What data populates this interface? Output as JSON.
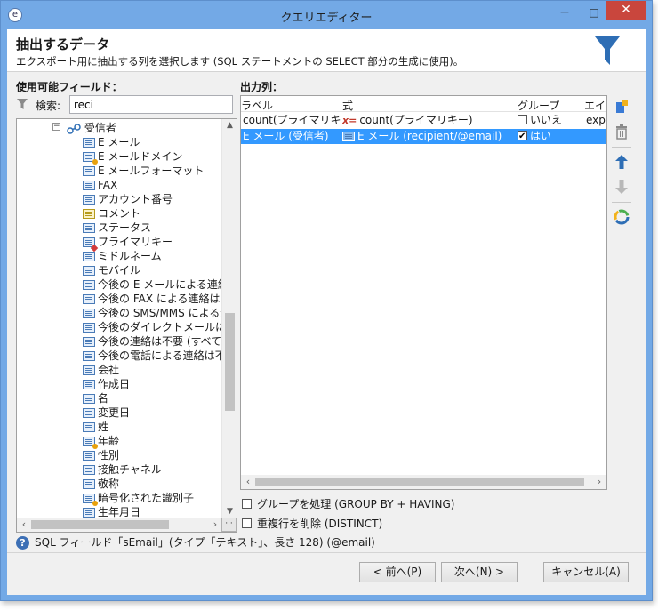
{
  "window": {
    "title": "クエリエディター",
    "minimize": "−",
    "maximize": "□",
    "close": "✕"
  },
  "header": {
    "title": "抽出するデータ",
    "description": "エクスポート用に抽出する列を選択します (SQL ステートメントの SELECT 部分の生成に使用)。"
  },
  "left": {
    "label": "使用可能フィールド：",
    "search_label": "検索:",
    "search_value": "reci",
    "tree": {
      "root_expander": "−",
      "root": "受信者",
      "items": [
        {
          "label": "E メール",
          "icon": "field-icon"
        },
        {
          "label": "E メールドメイン",
          "icon": "computed-field-icon"
        },
        {
          "label": "E メールフォーマット",
          "icon": "field-icon"
        },
        {
          "label": "FAX",
          "icon": "field-icon"
        },
        {
          "label": "アカウント番号",
          "icon": "field-icon"
        },
        {
          "label": "コメント",
          "icon": "memo-field-icon"
        },
        {
          "label": "ステータス",
          "icon": "field-icon"
        },
        {
          "label": "プライマリキー",
          "icon": "primary-key-icon"
        },
        {
          "label": "ミドルネーム",
          "icon": "field-icon"
        },
        {
          "label": "モバイル",
          "icon": "field-icon"
        },
        {
          "label": "今後の E メールによる連絡は",
          "icon": "field-icon"
        },
        {
          "label": "今後の FAX による連絡は不",
          "icon": "field-icon"
        },
        {
          "label": "今後の SMS/MMS による連",
          "icon": "field-icon"
        },
        {
          "label": "今後のダイレクトメールによる連",
          "icon": "field-icon"
        },
        {
          "label": "今後の連絡は不要 (すべての",
          "icon": "field-icon"
        },
        {
          "label": "今後の電話による連絡は不要",
          "icon": "field-icon"
        },
        {
          "label": "会社",
          "icon": "field-icon"
        },
        {
          "label": "作成日",
          "icon": "field-icon"
        },
        {
          "label": "名",
          "icon": "field-icon"
        },
        {
          "label": "変更日",
          "icon": "field-icon"
        },
        {
          "label": "姓",
          "icon": "field-icon"
        },
        {
          "label": "年齢",
          "icon": "computed-field-icon"
        },
        {
          "label": "性別",
          "icon": "field-icon"
        },
        {
          "label": "接触チャネル",
          "icon": "field-icon"
        },
        {
          "label": "敬称",
          "icon": "field-icon"
        },
        {
          "label": "暗号化された識別子",
          "icon": "computed-field-icon"
        },
        {
          "label": "生年月日",
          "icon": "field-icon"
        }
      ]
    },
    "scroll_up": "▲",
    "scroll_down": "▼",
    "scroll_left": "‹",
    "scroll_right": "›",
    "corner_button": "···"
  },
  "right": {
    "label": "出力列：",
    "columns": [
      "ラベル",
      "式",
      "グループ",
      "エイリ"
    ],
    "rows": [
      {
        "label": "count(プライマリキー)",
        "expression": "count(プライマリキー)",
        "expression_icon": "x=",
        "group": "いいえ",
        "group_checked": false,
        "alias": "exp",
        "selected": false
      },
      {
        "label": "E メール (受信者)",
        "expression": "E メール (recipient/@email)",
        "expression_icon": "field-icon",
        "group": "はい",
        "group_checked": true,
        "alias": "",
        "selected": true
      }
    ],
    "scroll_left": "‹",
    "scroll_right": "›",
    "options": [
      {
        "label": "グループを処理 (GROUP BY + HAVING)",
        "checked": false
      },
      {
        "label": "重複行を削除 (DISTINCT)",
        "checked": false
      }
    ]
  },
  "status": {
    "text": "SQL フィールド「sEmail」(タイプ「テキスト」、長さ 128) (@email)"
  },
  "footer": {
    "back": "< 前へ(P)",
    "next": "次へ(N) >",
    "cancel": "キャンセル(A)"
  },
  "colors": {
    "selection": "#3399ff",
    "frame": "#73a9e6",
    "close": "#c9463d",
    "funnel": "#2e6eb5"
  }
}
